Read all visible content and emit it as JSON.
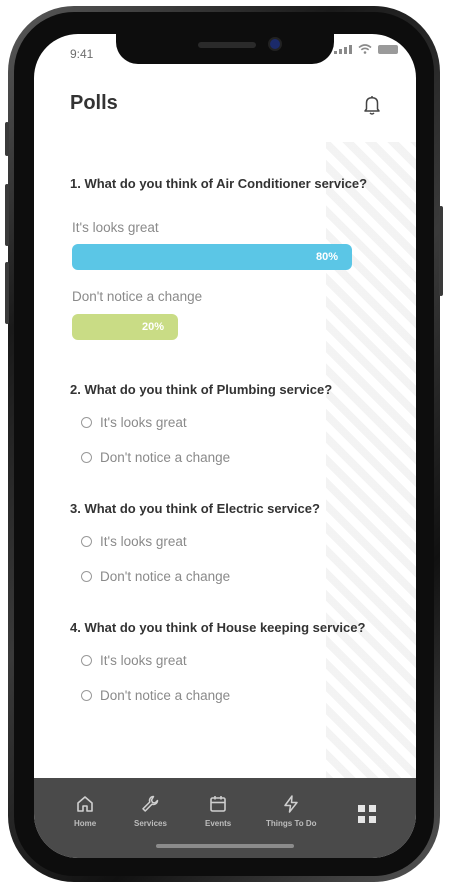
{
  "status": {
    "time": "9:41"
  },
  "header": {
    "title": "Polls"
  },
  "colors": {
    "bar_primary": "#5bc6e6",
    "bar_secondary": "#c9dc85",
    "tabbar": "#4a4a4a"
  },
  "polls": [
    {
      "question": "1. What do you think of Air Conditioner service?",
      "results": [
        {
          "label": "It's looks great",
          "percent_text": "80%",
          "percent": 80
        },
        {
          "label": "Don't notice a change",
          "percent_text": "20%",
          "percent": 20
        }
      ]
    },
    {
      "question": "2. What do you think of Plumbing service?",
      "options": [
        "It's looks great",
        "Don't notice a change"
      ]
    },
    {
      "question": "3. What do you think of Electric service?",
      "options": [
        "It's looks great",
        "Don't notice a change"
      ]
    },
    {
      "question": "4. What do you think of House keeping service?",
      "options": [
        "It's looks great",
        "Don't notice a change"
      ]
    }
  ],
  "tabbar": {
    "items": [
      {
        "label": "Home",
        "icon": "home-icon"
      },
      {
        "label": "Services",
        "icon": "wrench-icon"
      },
      {
        "label": "Events",
        "icon": "calendar-icon"
      },
      {
        "label": "Things To Do",
        "icon": "lightning-icon"
      }
    ],
    "menu_icon": "grid-icon"
  }
}
